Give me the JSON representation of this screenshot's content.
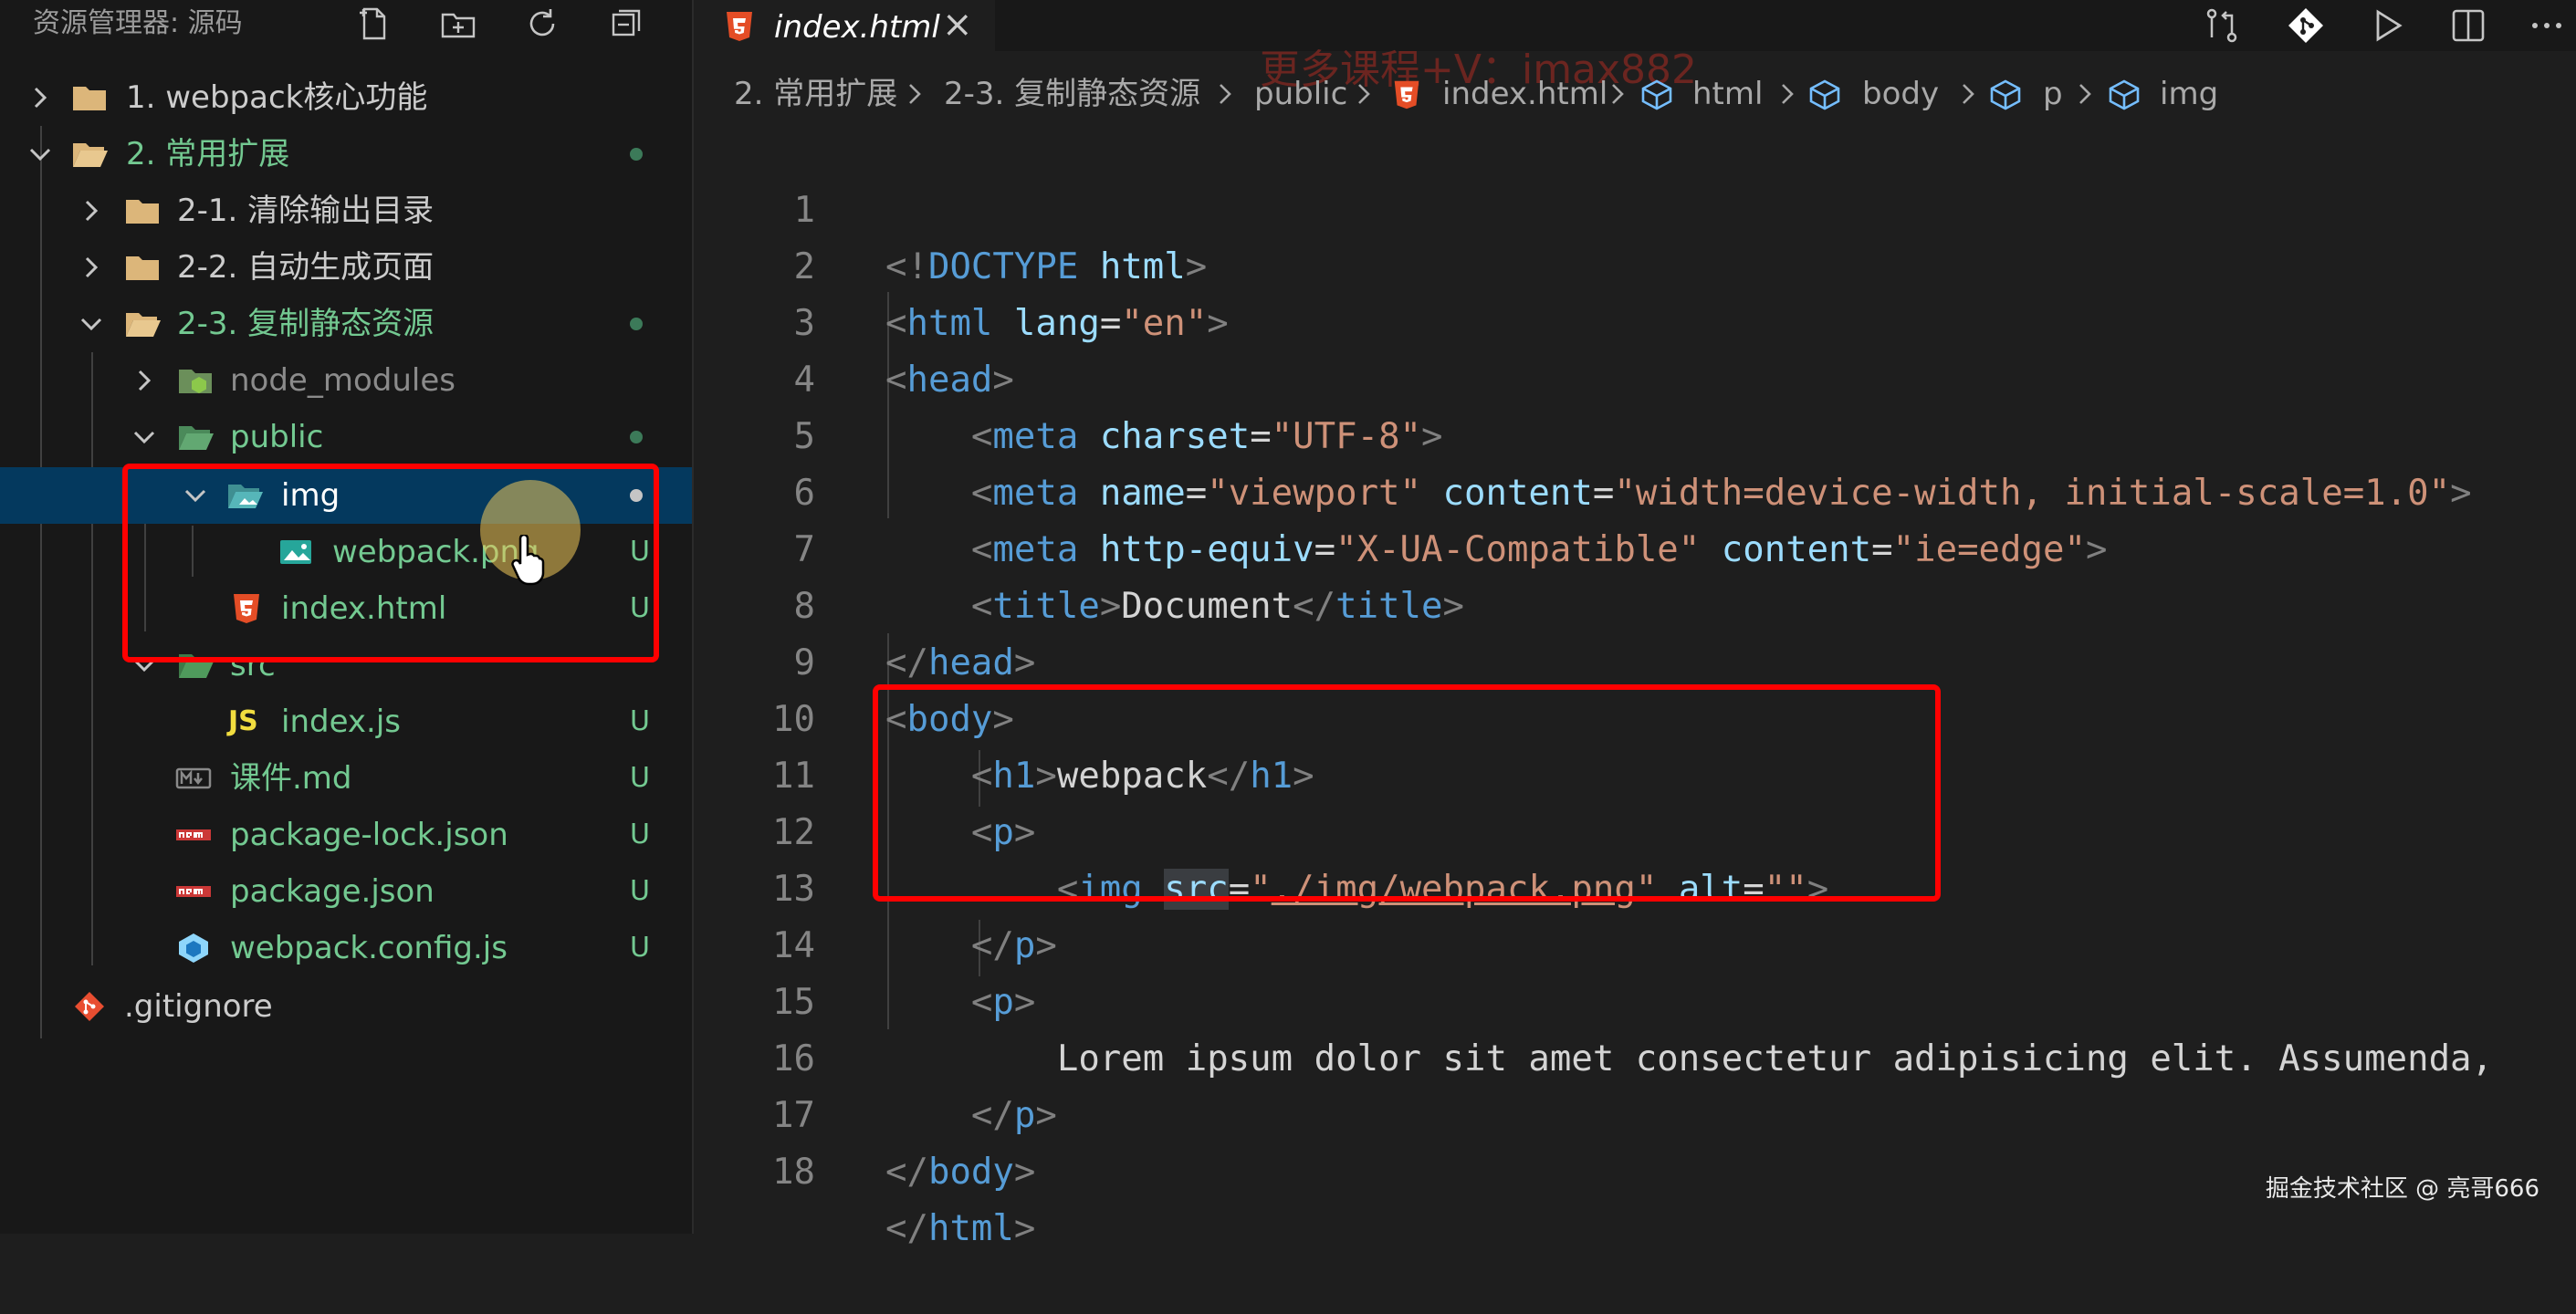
{
  "explorer": {
    "title": "资源管理器: 源码",
    "actions": [
      "new-file-icon",
      "new-folder-icon",
      "refresh-icon",
      "collapse-all-icon"
    ],
    "items": [
      {
        "label": "1. webpack核心功能",
        "type": "folder",
        "expanded": false,
        "status": ""
      },
      {
        "label": "2. 常用扩展",
        "type": "folder",
        "expanded": true,
        "status": "dot"
      },
      {
        "label": "2-1. 清除输出目录",
        "type": "folder",
        "expanded": false,
        "status": ""
      },
      {
        "label": "2-2. 自动生成页面",
        "type": "folder",
        "expanded": false,
        "status": ""
      },
      {
        "label": "2-3. 复制静态资源",
        "type": "folder",
        "expanded": true,
        "status": "dot"
      },
      {
        "label": "node_modules",
        "type": "folder-node",
        "expanded": false,
        "status": ""
      },
      {
        "label": "public",
        "type": "folder-public",
        "expanded": true,
        "status": "dot"
      },
      {
        "label": "img",
        "type": "folder-img",
        "expanded": true,
        "status": "dot"
      },
      {
        "label": "webpack.png",
        "type": "image",
        "status": "U"
      },
      {
        "label": "index.html",
        "type": "html",
        "status": "U"
      },
      {
        "label": "src",
        "type": "folder-src",
        "expanded": true,
        "status": ""
      },
      {
        "label": "index.js",
        "type": "js",
        "status": "U"
      },
      {
        "label": "课件.md",
        "type": "md",
        "status": "U"
      },
      {
        "label": "package-lock.json",
        "type": "npm",
        "status": "U"
      },
      {
        "label": "package.json",
        "type": "npm",
        "status": "U"
      },
      {
        "label": "webpack.config.js",
        "type": "webpack",
        "status": "U"
      },
      {
        "label": ".gitignore",
        "type": "git",
        "status": ""
      }
    ]
  },
  "tab": {
    "label": "index.html",
    "close": "×"
  },
  "editor_actions": [
    "compare-changes-icon",
    "git-icon",
    "run-icon",
    "split-editor-icon",
    "more-icon"
  ],
  "breadcrumb": [
    "2. 常用扩展",
    "2-3. 复制静态资源",
    "public",
    "index.html",
    "html",
    "body",
    "p",
    "img"
  ],
  "watermarks": {
    "top": "更多课程+V：imax882",
    "bottom": "掘金技术社区 @ 亮哥666"
  },
  "code": {
    "line_numbers": [
      "1",
      "2",
      "3",
      "4",
      "5",
      "6",
      "7",
      "8",
      "9",
      "10",
      "11",
      "12",
      "13",
      "14",
      "15",
      "16",
      "17",
      "18"
    ],
    "l1": {
      "a": "<!",
      "b": "DOCTYPE",
      "c": " ",
      "d": "html",
      "e": ">"
    },
    "l2": {
      "tag": "html",
      "attr": "lang",
      "val": "\"en\""
    },
    "l3": {
      "tag": "head"
    },
    "l4": {
      "tag": "meta",
      "attr": "charset",
      "val": "\"UTF-8\""
    },
    "l5": {
      "tag": "meta",
      "attr1": "name",
      "val1": "\"viewport\"",
      "attr2": "content",
      "val2": "\"width=device-width, initial-scale=1.0\""
    },
    "l6": {
      "tag": "meta",
      "attr1": "http-equiv",
      "val1": "\"X-UA-Compatible\"",
      "attr2": "content",
      "val2": "\"ie=edge\""
    },
    "l7": {
      "tag": "title",
      "text": "Document"
    },
    "l8": {
      "tag": "head"
    },
    "l9": {
      "tag": "body"
    },
    "l10": {
      "tag": "h1",
      "text": "webpack"
    },
    "l11": {
      "tag": "p"
    },
    "l12": {
      "tag": "img",
      "attr1": "src",
      "val1_q": "\"",
      "val1": "./img/webpack.png",
      "attr2": "alt",
      "val2": "\"\""
    },
    "l13": {
      "tag": "p"
    },
    "l14": {
      "tag": "p"
    },
    "l15": {
      "text": "Lorem ipsum dolor sit amet consectetur adipisicing elit. Assumenda,"
    },
    "l16": {
      "tag": "p"
    },
    "l17": {
      "tag": "body"
    },
    "l18": {
      "tag": "html"
    }
  },
  "colors": {
    "selection": "#04395e",
    "annotation": "#ff0000",
    "untracked": "#73c991"
  }
}
